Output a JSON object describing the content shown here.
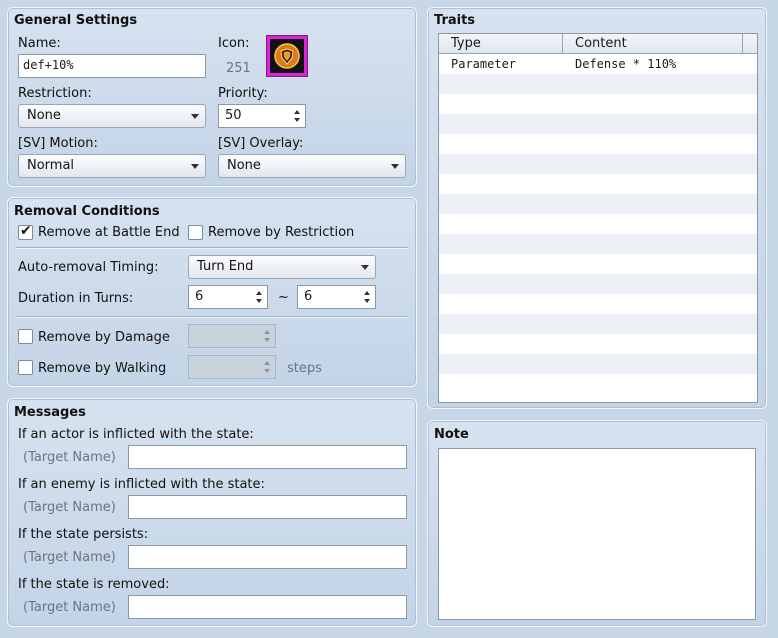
{
  "general": {
    "title": "General Settings",
    "name_label": "Name:",
    "name_value": "def+10%",
    "icon_label": "Icon:",
    "icon_index": "251",
    "restriction_label": "Restriction:",
    "restriction_value": "None",
    "priority_label": "Priority:",
    "priority_value": "50",
    "motion_label": "[SV] Motion:",
    "motion_value": "Normal",
    "overlay_label": "[SV] Overlay:",
    "overlay_value": "None"
  },
  "removal": {
    "title": "Removal Conditions",
    "battle_end_label": "Remove at Battle End",
    "battle_end_checked": true,
    "restriction_label": "Remove by Restriction",
    "restriction_checked": false,
    "timing_label": "Auto-removal Timing:",
    "timing_value": "Turn End",
    "duration_label": "Duration in Turns:",
    "duration_min": "6",
    "duration_sep": "~",
    "duration_max": "6",
    "damage_label": "Remove by Damage",
    "damage_checked": false,
    "walking_label": "Remove by Walking",
    "walking_checked": false,
    "steps_label": "steps"
  },
  "messages": {
    "title": "Messages",
    "actor_label": "If an actor is inflicted with the state:",
    "enemy_label": "If an enemy is inflicted with the state:",
    "persists_label": "If the state persists:",
    "removed_label": "If the state is removed:",
    "target_name": "(Target Name)"
  },
  "traits": {
    "title": "Traits",
    "col_type": "Type",
    "col_content": "Content",
    "rows": [
      {
        "type": "Parameter",
        "content": "Defense * 110%"
      }
    ]
  },
  "note": {
    "title": "Note"
  },
  "colors": {
    "panel_bg": "#c8d7e8",
    "icon_border": "#e020e0"
  }
}
